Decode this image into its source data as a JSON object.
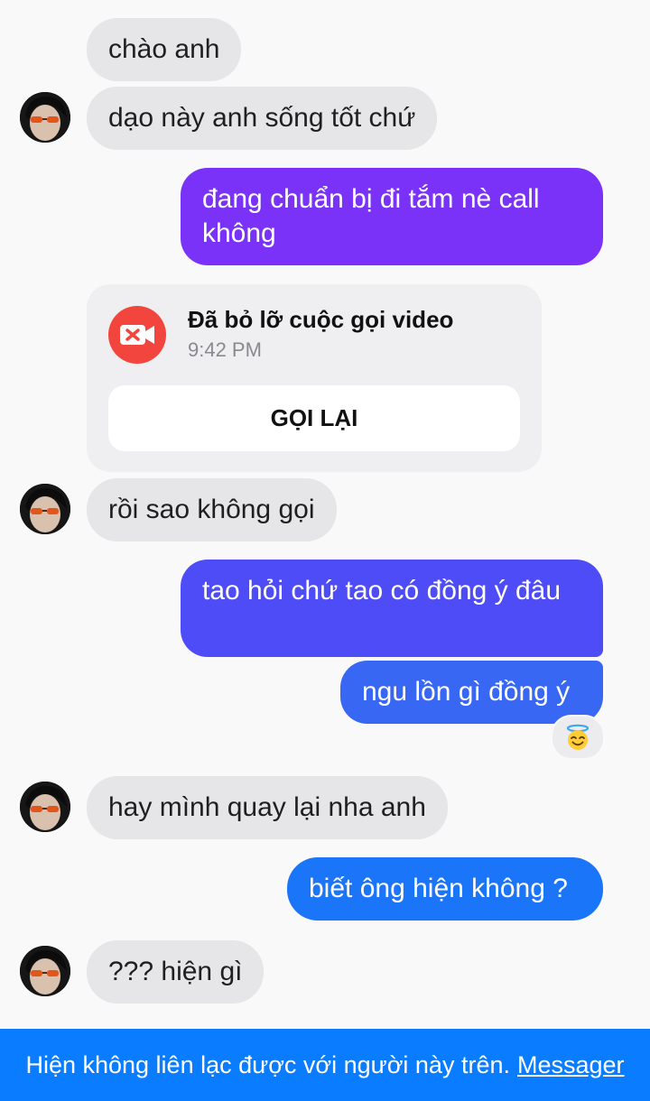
{
  "colors": {
    "incoming_bubble": "#e6e6e8",
    "outgoing_purple": "#7a32f8",
    "outgoing_indigo": "#4e4cf6",
    "outgoing_blue": "#3867f4",
    "outgoing_bright_blue": "#1b75f8",
    "missed_call_red": "#f2453d",
    "footer_blue": "#0a7cff"
  },
  "messages": {
    "m1": "chào anh",
    "m2": "dạo này anh sống tốt chứ",
    "m3": "đang chuẩn bị đi tắm nè call không",
    "m4": "rồi sao không gọi",
    "m5": "tao hỏi chứ tao có đồng ý đâu",
    "m6": "ngu lồn gì đồng ý",
    "m7": "hay mình quay lại nha anh",
    "m8": "biết ông hiện không ?",
    "m9": "??? hiện gì"
  },
  "missed_call": {
    "icon": "video-camera-x-icon",
    "title": "Đã bỏ lỡ cuộc gọi video",
    "time": "9:42 PM",
    "button_label": "GỌI LẠI"
  },
  "reaction": {
    "icon": "smiling-face-with-halo-emoji"
  },
  "footer": {
    "text": "Hiện không liên lạc được với người này trên.",
    "link": "Messager"
  }
}
